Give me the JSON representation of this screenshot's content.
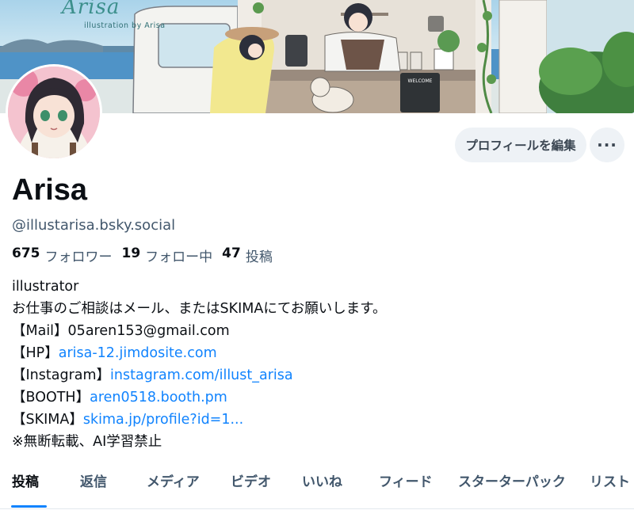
{
  "banner": {
    "title": "Arisa",
    "subtitle": "illustration by Arisa",
    "sign_label": "WELCOME"
  },
  "actions": {
    "edit_profile": "プロフィールを編集",
    "more": "···"
  },
  "profile": {
    "display_name": "Arisa",
    "handle": "@illustarisa.bsky.social",
    "stats": {
      "followers_count": "675",
      "followers_label": "フォロワー",
      "following_count": "19",
      "following_label": "フォロー中",
      "posts_count": "47",
      "posts_label": "投稿"
    },
    "bio": {
      "line1": "illustrator",
      "line2": "お仕事のご相談はメール、またはSKIMAにてお願いします。",
      "mail_prefix": "【Mail】05aren153@gmail.com",
      "hp_prefix": "【HP】",
      "hp_link": "arisa-12.jimdosite.com",
      "instagram_prefix": "【Instagram】",
      "instagram_link": "instagram.com/illust_arisa",
      "booth_prefix": "【BOOTH】",
      "booth_link": "aren0518.booth.pm",
      "skima_prefix": "【SKIMA】",
      "skima_link": "skima.jp/profile?id=1...",
      "notice": "※無断転載、AI学習禁止"
    }
  },
  "tabs": [
    "投稿",
    "返信",
    "メディア",
    "ビデオ",
    "いいね",
    "フィード",
    "スターターパック",
    "リスト"
  ],
  "colors": {
    "link": "#1083fe",
    "text_primary": "#0b0f14",
    "text_secondary": "#42576c",
    "button_bg": "#eef2f6"
  }
}
